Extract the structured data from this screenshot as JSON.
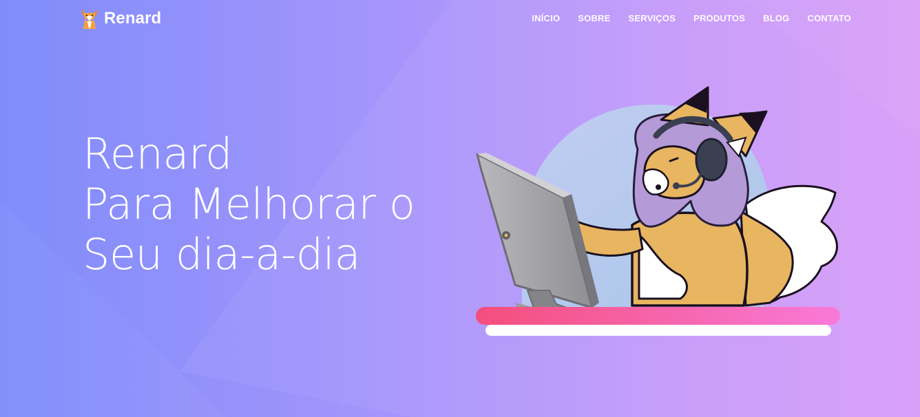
{
  "brand": {
    "name": "Renard",
    "icon": "fox-logo-icon"
  },
  "nav": {
    "items": [
      "INÍCIO",
      "SOBRE",
      "SERVIÇOS",
      "PRODUTOS",
      "BLOG",
      "CONTATO"
    ]
  },
  "hero": {
    "lines": [
      "Renard",
      "Para Melhorar o",
      "Seu dia-a-dia"
    ],
    "illustration": "fox-girl-at-computer-illustration"
  },
  "colors": {
    "gradient_start": "#7f8dfb",
    "gradient_end": "#d79bf8",
    "desk_pink_left": "#f44e7c",
    "desk_pink_right": "#f87ad8",
    "fox_orange": "#e8b560",
    "hair_purple": "#b59ad8"
  }
}
